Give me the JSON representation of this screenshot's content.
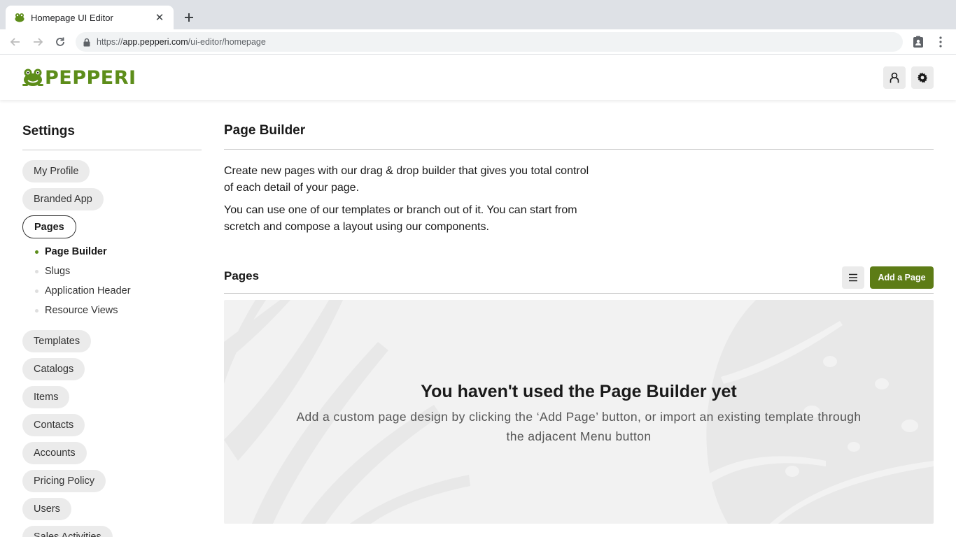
{
  "browser": {
    "tab_title": "Homepage UI Editor",
    "url_scheme": "https://",
    "url_host": "app.pepperi.com",
    "url_path": "/ui-editor/homepage"
  },
  "header": {
    "logo_text": "PEPPERI",
    "brand_color": "#5d8d1a"
  },
  "sidebar": {
    "title": "Settings",
    "items": [
      {
        "label": "My Profile"
      },
      {
        "label": "Branded App"
      },
      {
        "label": "Pages",
        "active": true
      },
      {
        "label": "Templates"
      },
      {
        "label": "Catalogs"
      },
      {
        "label": "Items"
      },
      {
        "label": "Contacts"
      },
      {
        "label": "Accounts"
      },
      {
        "label": "Pricing Policy"
      },
      {
        "label": "Users"
      },
      {
        "label": "Sales Activities"
      }
    ],
    "sub_items": [
      {
        "label": "Page Builder",
        "active": true
      },
      {
        "label": "Slugs"
      },
      {
        "label": "Application Header"
      },
      {
        "label": "Resource Views"
      }
    ]
  },
  "main": {
    "title": "Page Builder",
    "description_1": "Create new pages with our drag & drop builder that gives you total control of each detail of your page.",
    "description_2": "You can use one of our templates or branch out of it. You can start from scretch and compose a layout using our components.",
    "section_title": "Pages",
    "add_button_label": "Add a Page",
    "empty_title": "You haven't used the Page Builder yet",
    "empty_text": "Add a custom page design by clicking the ‘Add Page’ button, or import an existing template through the adjacent Menu button"
  },
  "colors": {
    "accent_button": "#5d7c16",
    "pill_bg": "#ebebeb",
    "empty_bg": "#f2f2f2"
  }
}
